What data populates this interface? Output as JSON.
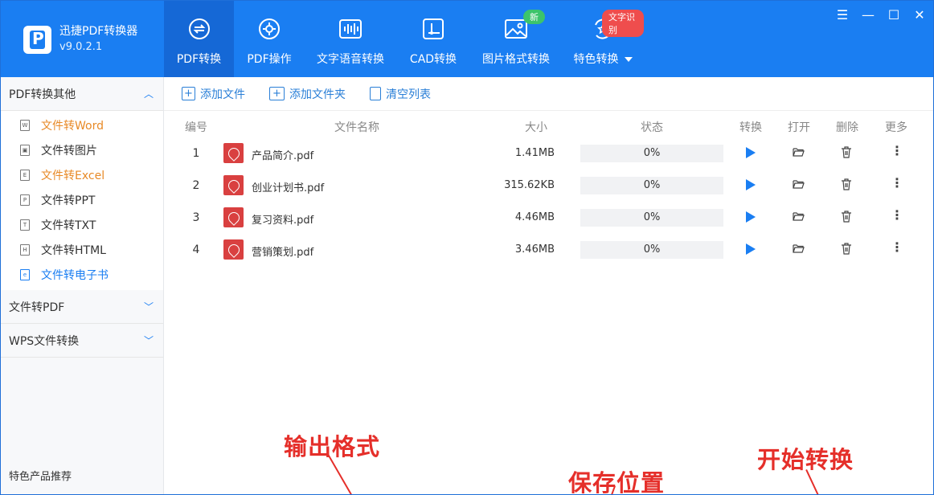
{
  "app": {
    "name": "迅捷PDF转换器",
    "version": "v9.0.2.1"
  },
  "nav": [
    {
      "label": "PDF转换",
      "icon": "convert-icon",
      "active": true
    },
    {
      "label": "PDF操作",
      "icon": "settings-cog-icon"
    },
    {
      "label": "文字语音转换",
      "icon": "waveform-icon"
    },
    {
      "label": "CAD转换",
      "icon": "cad-icon"
    },
    {
      "label": "图片格式转换",
      "icon": "image-icon",
      "badge": "新"
    },
    {
      "label": "特色转换",
      "icon": "star-refresh-icon",
      "badge": "文字识别",
      "dropdown": true
    }
  ],
  "window_controls": [
    "menu-icon",
    "minimize-icon",
    "maximize-icon",
    "close-icon"
  ],
  "sidebar": {
    "groups": [
      {
        "label": "PDF转换其他",
        "expanded": true,
        "items": [
          {
            "label": "文件转Word",
            "glyph": "W",
            "color": "orange"
          },
          {
            "label": "文件转图片",
            "glyph": "▣",
            "color": "default"
          },
          {
            "label": "文件转Excel",
            "glyph": "E",
            "color": "orange"
          },
          {
            "label": "文件转PPT",
            "glyph": "P",
            "color": "default"
          },
          {
            "label": "文件转TXT",
            "glyph": "T",
            "color": "default"
          },
          {
            "label": "文件转HTML",
            "glyph": "H",
            "color": "default"
          },
          {
            "label": "文件转电子书",
            "glyph": "e",
            "color": "blue"
          }
        ]
      },
      {
        "label": "文件转PDF",
        "expanded": false
      },
      {
        "label": "WPS文件转换",
        "expanded": false
      }
    ],
    "promo": "特色产品推荐"
  },
  "toolbar": {
    "add_file": "添加文件",
    "add_folder": "添加文件夹",
    "clear_list": "清空列表"
  },
  "table": {
    "headers": {
      "number": "编号",
      "name": "文件名称",
      "size": "大小",
      "status": "状态",
      "convert": "转换",
      "open": "打开",
      "delete": "删除",
      "more": "更多"
    },
    "rows": [
      {
        "number": "1",
        "name": "产品简介.pdf",
        "size": "1.41MB",
        "progress": "0%",
        "progress_value": 0
      },
      {
        "number": "2",
        "name": "创业计划书.pdf",
        "size": "315.62KB",
        "progress": "0%",
        "progress_value": 0
      },
      {
        "number": "3",
        "name": "复习资料.pdf",
        "size": "4.46MB",
        "progress": "0%",
        "progress_value": 0
      },
      {
        "number": "4",
        "name": "营销策划.pdf",
        "size": "3.46MB",
        "progress": "0%",
        "progress_value": 0
      }
    ]
  },
  "annotations": {
    "output_format": "输出格式",
    "save_location": "保存位置",
    "start_convert": "开始转换"
  },
  "colors": {
    "brand": "#1a7ef2",
    "accent_red": "#e52f2a",
    "badge_green": "#3cc46b",
    "badge_red": "#ef4d4d"
  }
}
